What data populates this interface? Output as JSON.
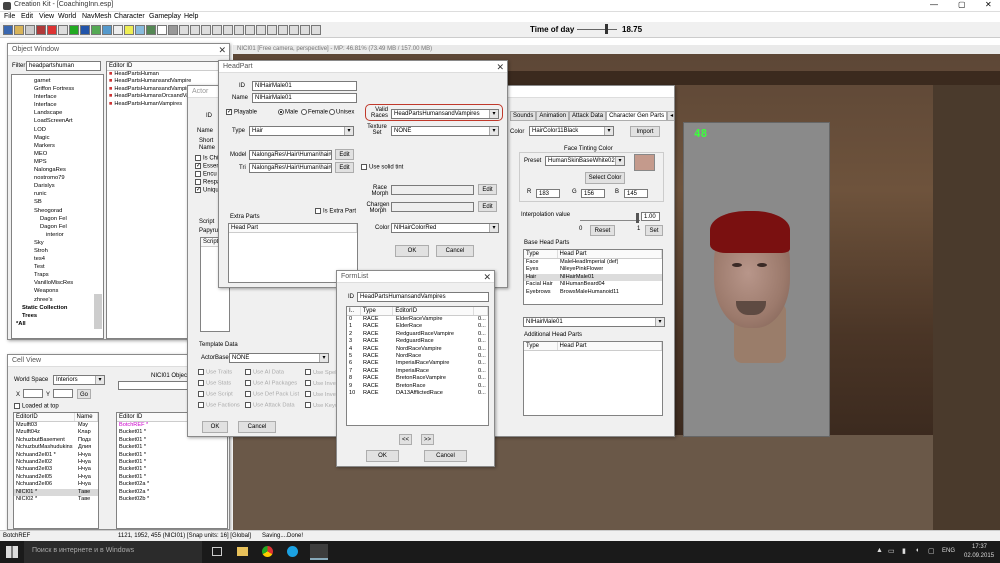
{
  "app": {
    "title": "Creation Kit - [CoachingInn.esp]",
    "menus": [
      "File",
      "Edit",
      "View",
      "World",
      "NavMesh",
      "Character",
      "Gameplay",
      "Help"
    ],
    "time_label": "Time of day",
    "time_value": "18.75"
  },
  "colors": {
    "accent_red": "#c0392b",
    "tint_swatch": "#c49a8c",
    "fps_green": "#3cff3c"
  },
  "viewport": {
    "title": "NICI01 [Free camera, perspective] - MP: 46.81% (73.49 MB / 157.00 MB)"
  },
  "object_window": {
    "title": "Object Window",
    "filter_label": "Filter",
    "filter_value": "headpartshuman",
    "tree": [
      "garnet",
      "Griffon Fortress",
      "Interface",
      "Interface",
      "Landscape",
      "LoadScreenArt",
      "LOD",
      "Magic",
      "Markers",
      "MEO",
      "MPS",
      "NalongaRes",
      "nostromo79",
      "Darislys",
      "runic",
      "SB",
      "Sheogorad",
      "Dagon Fel",
      "Dagon Fel",
      "interior",
      "Sky",
      "Stroh",
      "tes4",
      "Test",
      "Traps",
      "VanilloMiscRes",
      "Weapons",
      "zhree's",
      "Static Collection",
      "Trees",
      "*All"
    ],
    "list_header": "Editor ID",
    "list_items": [
      "HeadPartsHuman",
      "HeadPartsHumansandVampire",
      "HeadPartsHumansandVampir",
      "HeadPartsHumansOrcsandVa",
      "HeadPartsHumanVampires"
    ]
  },
  "cell_view": {
    "title": "Cell View",
    "world_space_label": "World Space",
    "world_space_value": "Interiors",
    "x_label": "X",
    "y_label": "Y",
    "go_label": "Go",
    "loaded_label": "Loaded at top",
    "cell_objects_label": "NICI01 Objects",
    "left_headers": [
      "EditorID",
      "Name"
    ],
    "left_rows": [
      [
        "Mzulft03",
        "Мзу"
      ],
      [
        "Mzulft04z",
        "Клар"
      ],
      [
        "NchuzbutBasement",
        "Подз"
      ],
      [
        "NchuzbutMashudukins",
        "Длия"
      ],
      [
        "Nchuand2el01 *",
        "Нчуа"
      ],
      [
        "Nchuand2el02",
        "Нчуа"
      ],
      [
        "Nchuand2el03",
        "Нчуа"
      ],
      [
        "Nchuand2el05",
        "Нчуа"
      ],
      [
        "Nchuand2el06",
        "Нчуа"
      ],
      [
        "NICI01 *",
        "Таве"
      ],
      [
        "NICI02 *",
        "Таве"
      ]
    ],
    "right_header": "Editor ID",
    "right_rows": [
      "BotchREF *",
      "Bucket01 *",
      "Bucket01 *",
      "Bucket01 *",
      "Bucket01 *",
      "Bucket01 *",
      "Bucket01 *",
      "Bucket01 *",
      "Bucket02a *",
      "Bucket02a *",
      "Bucket02b *"
    ]
  },
  "actor": {
    "title": "Actor",
    "id_label": "ID",
    "name_label": "Name",
    "short_label": "Short",
    "name2_label": "Name",
    "checks": [
      "Is Chi",
      "Essen",
      "Encu",
      "Respa",
      "Uniqu"
    ],
    "tabs": [
      "Sounds",
      "Animation",
      "Attack Data",
      "Character Gen Parts"
    ],
    "hair_color_label": "Color",
    "hair_color_value": "HairColor11Black",
    "import_label": "Import",
    "face_tint_title": "Face Tinting Color",
    "preset_label": "Preset",
    "preset_value": "HumanSkinBaseWhite02",
    "select_color_label": "Select Color",
    "r_label": "R",
    "r_value": "183",
    "g_label": "G",
    "g_value": "156",
    "b_label": "B",
    "b_value": "145",
    "interp_label": "Interpolation value",
    "interp_value": "1.00",
    "interp_min": "0",
    "interp_max": "1",
    "reset_label": "Reset",
    "set_label": "Set",
    "base_head_parts_label": "Base Head Parts",
    "bhp_headers": [
      "Type",
      "Head Part"
    ],
    "bhp_rows": [
      [
        "Face",
        "MaleHeadImperial (def)"
      ],
      [
        "Eyes",
        "NileyePinkFlower"
      ],
      [
        "Hair",
        "NIHairMale01"
      ],
      [
        "Facial Hair",
        "NIHumanBeard04"
      ],
      [
        "Eyebrows",
        "BrowsMaleHumanoid11"
      ]
    ],
    "selected_part": "NIHairMale01",
    "additional_label": "Additional Head Parts",
    "add_headers": [
      "Type",
      "Head Part"
    ],
    "fps": "48",
    "script_label": "Script",
    "papyrus_label": "Papyrus",
    "script_header": "Script",
    "template_label": "Template Data",
    "actor_base_label": "ActorBase",
    "actor_base_value": "NONE",
    "template_checks": [
      [
        "Use Traits",
        "Use AI Data",
        "Use Spel"
      ],
      [
        "Use Stats",
        "Use AI Packages",
        "Use Inve"
      ],
      [
        "Use Script",
        "Use Def Pack List",
        "Use Inve"
      ],
      [
        "Use Factions",
        "Use Attack Data",
        "Use Keyw"
      ]
    ],
    "ok_label": "OK",
    "cancel_label": "Cancel"
  },
  "headpart": {
    "title": "HeadPart",
    "id_label": "ID",
    "id_value": "NIHairMale01",
    "name_label": "Name",
    "name_value": "NIHairMale01",
    "playable_label": "Playable",
    "male_label": "Male",
    "female_label": "Female",
    "unisex_label": "Unisex",
    "type_label": "Type",
    "type_value": "Hair",
    "model_label": "Model",
    "model_value": "NalongaRes\\Hair\\Human\\hair02",
    "tri_label": "Tri",
    "tri_value": "NalongaRes\\Hair\\Human\\hair02",
    "edit_label": "Edit",
    "valid_races_label": "Valid Races",
    "valid_races_value": "HeadPartsHumansandVampires",
    "texture_set_label": "Texture Set",
    "texture_set_value": "NONE",
    "solid_tint_label": "Use solid tint",
    "race_morph_label": "Race Morph",
    "chargen_morph_label": "Chargen Morph",
    "extra_parts_label": "Extra Parts",
    "is_extra_part_label": "Is Extra Part",
    "head_part_header": "Head Part",
    "color_label": "Color",
    "color_value": "NIHairColorRed",
    "ok_label": "OK",
    "cancel_label": "Cancel"
  },
  "formlist": {
    "title": "FormList",
    "id_label": "ID",
    "id_value": "HeadPartsHumansandVampires",
    "headers": [
      "I..",
      "Type",
      "EditorID",
      ""
    ],
    "rows": [
      [
        "0",
        "RACE",
        "ElderRaceVampire",
        "0..."
      ],
      [
        "1",
        "RACE",
        "ElderRace",
        "0..."
      ],
      [
        "2",
        "RACE",
        "RedguardRaceVampire",
        "0..."
      ],
      [
        "3",
        "RACE",
        "RedguardRace",
        "0..."
      ],
      [
        "4",
        "RACE",
        "NordRaceVampire",
        "0..."
      ],
      [
        "5",
        "RACE",
        "NordRace",
        "0..."
      ],
      [
        "6",
        "RACE",
        "ImperialRaceVampire",
        "0..."
      ],
      [
        "7",
        "RACE",
        "ImperialRace",
        "0..."
      ],
      [
        "8",
        "RACE",
        "BretonRaceVampire",
        "0..."
      ],
      [
        "9",
        "RACE",
        "BretonRace",
        "0..."
      ],
      [
        "10",
        "RACE",
        "DA13AfflictedRace",
        "0..."
      ]
    ],
    "prev_label": "<<",
    "next_label": ">>",
    "ok_label": "OK",
    "cancel_label": "Cancel"
  },
  "status": {
    "left": "BotchREF",
    "coords": "1121, 1952, 455 (NICI01) [Snap units: 16] [Global]",
    "message": "Saving....Done!"
  },
  "taskbar": {
    "search_placeholder": "Поиск в интернете и в Windows",
    "lang": "ENG",
    "time": "17:37",
    "date": "02.09.2015"
  }
}
